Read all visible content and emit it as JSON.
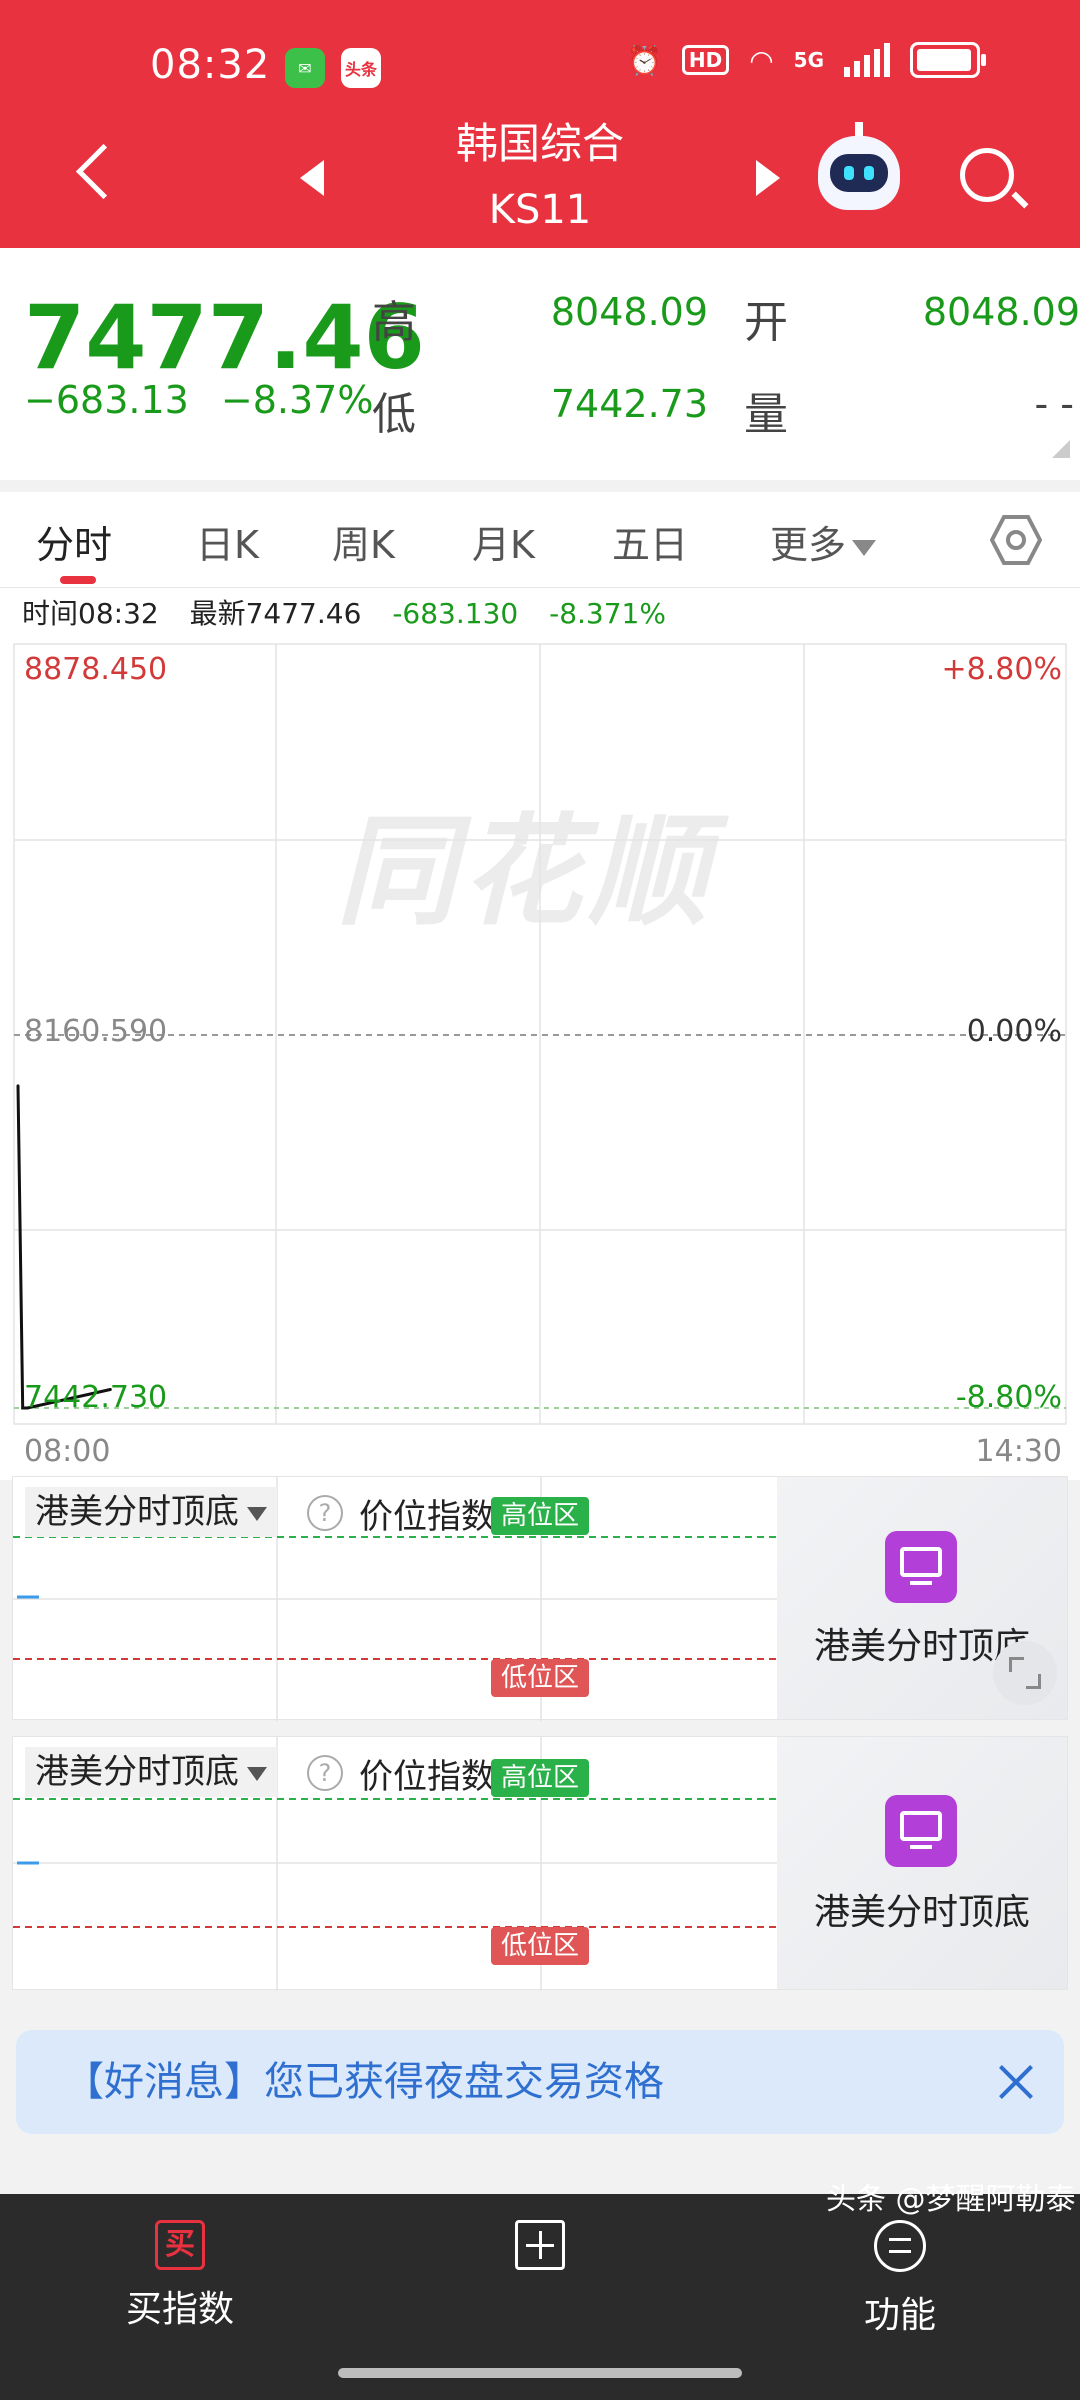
{
  "status_bar": {
    "time": "08:32",
    "app_badge_2": "头条",
    "hd": "HD",
    "network": "5G"
  },
  "header": {
    "title": "韩国综合",
    "subtitle": "KS11",
    "accent_color": "#e8323f"
  },
  "quote": {
    "price": "7477.46",
    "change": "−683.13",
    "change_pct": "−8.37%",
    "high_label": "高",
    "high": "8048.09",
    "low_label": "低",
    "low": "7442.73",
    "open_label": "开",
    "open": "8048.09",
    "volume_label": "量",
    "volume": "- -",
    "down_color": "#1a9a1a"
  },
  "tabs": [
    {
      "label": "分时",
      "active": true
    },
    {
      "label": "日K"
    },
    {
      "label": "周K"
    },
    {
      "label": "月K"
    },
    {
      "label": "五日"
    },
    {
      "label": "更多"
    }
  ],
  "info_row": {
    "time": "时间08:32",
    "latest": "最新7477.46",
    "change": "-683.130",
    "change_pct": "-8.371%"
  },
  "chart_data": {
    "type": "line",
    "y_max_label": "8878.450",
    "y_mid_label": "8160.590",
    "y_min_label": "7442.730",
    "pct_max_label": "+8.80%",
    "pct_mid_label": "0.00%",
    "pct_min_label": "-8.80%",
    "x_start_label": "08:00",
    "x_end_label": "14:30",
    "ylim": [
      7442.73,
      8878.45
    ],
    "x": [
      "08:00",
      "08:01",
      "08:02",
      "08:32"
    ],
    "values": [
      8048.09,
      7442.73,
      7442.73,
      7477.46
    ],
    "watermark": "同花顺"
  },
  "indicator_panels": [
    {
      "selector": "港美分时顶底",
      "help": "?",
      "name": "价位指数",
      "high_zone": "高位区",
      "low_zone": "低位区",
      "promo": "港美分时顶底"
    },
    {
      "selector": "港美分时顶底",
      "help": "?",
      "name": "价位指数",
      "high_zone": "高位区",
      "low_zone": "低位区",
      "promo": "港美分时顶底"
    }
  ],
  "banner": {
    "text": "【好消息】您已获得夜盘交易资格"
  },
  "bottom_nav": {
    "buy_icon_char": "买",
    "buy_label": "买指数",
    "func_label": "功能"
  },
  "credit": "头条 @梦醒阿勒泰"
}
